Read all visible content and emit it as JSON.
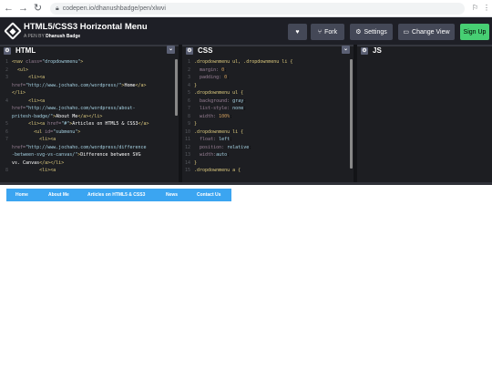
{
  "browser": {
    "url": "codepen.io/dhanushbadge/pen/xlwvi",
    "back_icon": "arrow-left-icon",
    "forward_icon": "arrow-right-icon",
    "reload_icon": "reload-icon"
  },
  "header": {
    "title": "HTML5/CSS3 Horizontal Menu",
    "author_prefix": "A PEN BY",
    "author": "Dhanush Badge",
    "fork_label": "Fork",
    "settings_label": "Settings",
    "change_view_label": "Change View",
    "signup_label": "Sign Up"
  },
  "editors": {
    "html": {
      "label": "HTML",
      "lines": [
        {
          "n": "1",
          "html": "<span class='t'>&lt;nav</span> <span class='a'>class=</span><span class='s'>\"dropdownmenu\"</span><span class='t'>&gt;</span>"
        },
        {
          "n": "2",
          "html": "  <span class='t'>&lt;ul&gt;</span>"
        },
        {
          "n": "3",
          "html": "      <span class='t'>&lt;li&gt;&lt;a</span>"
        },
        {
          "n": "",
          "html": "<span class='a'>href=</span><span class='s'>\"http://www.jochaho.com/wordpress/\"</span><span class='t'>&gt;</span><span class='p'>Home</span><span class='t'>&lt;/a&gt;</span>"
        },
        {
          "n": "",
          "html": "<span class='t'>&lt;/li&gt;</span>"
        },
        {
          "n": "4",
          "html": "      <span class='t'>&lt;li&gt;&lt;a</span>"
        },
        {
          "n": "",
          "html": "<span class='a'>href=</span><span class='s'>\"http://www.jochaho.com/wordpress/about-</span>"
        },
        {
          "n": "",
          "html": "<span class='s'>pritesh-badge/\"</span><span class='t'>&gt;</span><span class='p'>About Me</span><span class='t'>&lt;/a&gt;&lt;/li&gt;</span>"
        },
        {
          "n": "5",
          "html": "      <span class='t'>&lt;li&gt;&lt;a</span> <span class='a'>href=</span><span class='s'>\"#\"</span><span class='t'>&gt;</span><span class='p'>Articles on HTML5 &amp; CSS3</span><span class='t'>&lt;/a&gt;</span>"
        },
        {
          "n": "6",
          "html": "        <span class='t'>&lt;ul</span> <span class='a'>id=</span><span class='s'>\"submenu\"</span><span class='t'>&gt;</span>"
        },
        {
          "n": "7",
          "html": "          <span class='t'>&lt;li&gt;&lt;a</span>"
        },
        {
          "n": "",
          "html": "<span class='a'>href=</span><span class='s'>\"http://www.jochaho.com/wordpress/difference</span>"
        },
        {
          "n": "",
          "html": "<span class='s'>-between-svg-vs-canvas/\"</span><span class='t'>&gt;</span><span class='p'>Difference between SVG</span>"
        },
        {
          "n": "",
          "html": "<span class='p'>vs. Canvas</span><span class='t'>&lt;/a&gt;&lt;/li&gt;</span>"
        },
        {
          "n": "8",
          "html": "          <span class='t'>&lt;li&gt;&lt;a</span>"
        }
      ]
    },
    "css": {
      "label": "CSS",
      "lines": [
        {
          "n": "1",
          "html": "<span class='sel'>.dropdownmenu ul, .dropdownmenu li {</span>"
        },
        {
          "n": "2",
          "html": "  <span class='prop'>margin:</span> <span class='num'>0</span>;"
        },
        {
          "n": "3",
          "html": "  <span class='prop'>padding:</span> <span class='num'>0</span>;"
        },
        {
          "n": "4",
          "html": "<span class='sel'>}</span>"
        },
        {
          "n": "5",
          "html": "<span class='sel'>.dropdownmenu ul {</span>"
        },
        {
          "n": "6",
          "html": "  <span class='prop'>background:</span> <span class='val'>gray</span>;"
        },
        {
          "n": "7",
          "html": "  <span class='prop'>list-style:</span> <span class='val'>none</span>;"
        },
        {
          "n": "8",
          "html": "  <span class='prop'>width:</span> <span class='num'>100%</span>;"
        },
        {
          "n": "9",
          "html": "<span class='sel'>}</span>"
        },
        {
          "n": "10",
          "html": "<span class='sel'>.dropdownmenu li {</span>"
        },
        {
          "n": "11",
          "html": "  <span class='prop'>float:</span> <span class='val'>left</span>;"
        },
        {
          "n": "12",
          "html": "  <span class='prop'>position:</span> <span class='val'>relative</span>;"
        },
        {
          "n": "13",
          "html": "  <span class='prop'>width:</span><span class='val'>auto</span>;"
        },
        {
          "n": "14",
          "html": "<span class='sel'>}</span>"
        },
        {
          "n": "15",
          "html": "<span class='sel'>.dropdownmenu a {</span>"
        }
      ]
    },
    "js": {
      "label": "JS"
    }
  },
  "preview": {
    "menu": [
      "Home",
      "About Me",
      "Articles on HTML5 & CSS3",
      "News",
      "Contact Us"
    ]
  }
}
